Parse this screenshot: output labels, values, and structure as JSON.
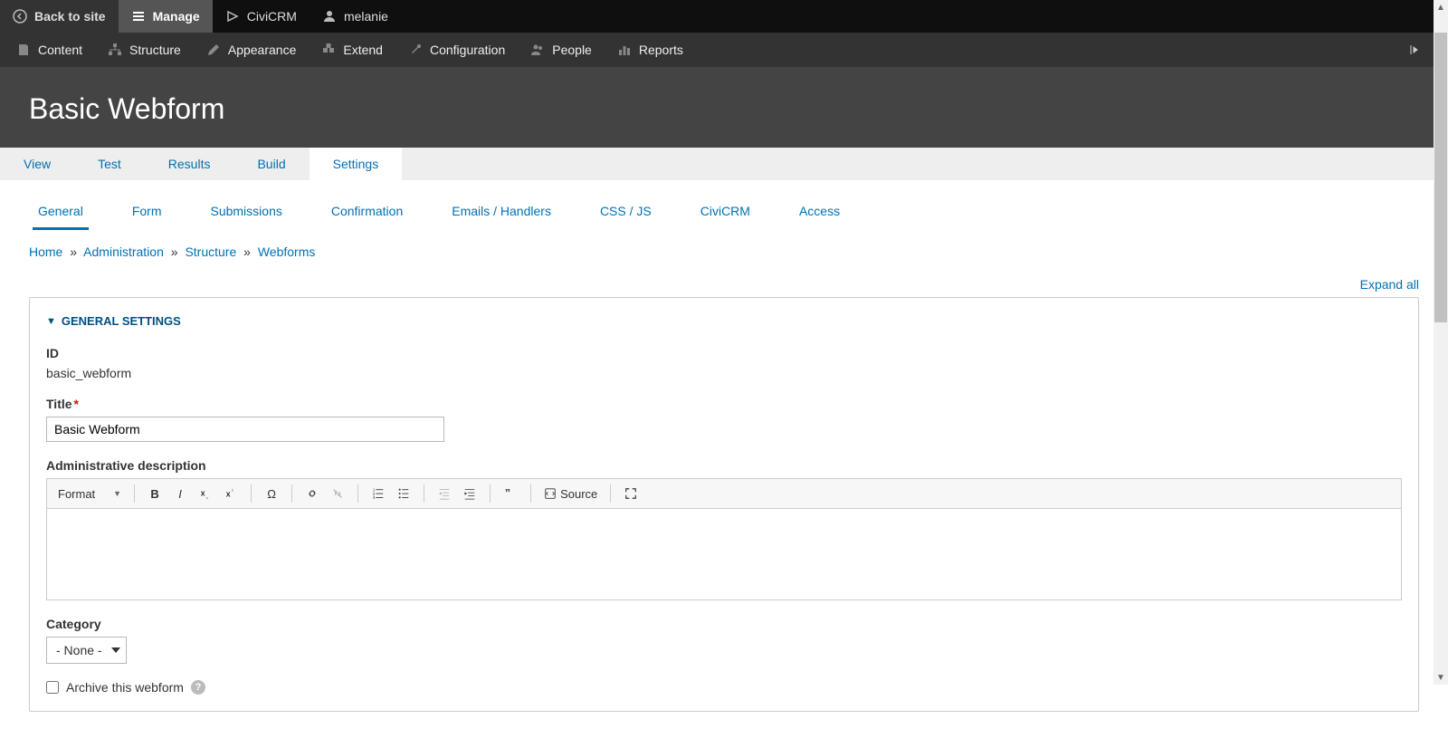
{
  "toolbar_top": {
    "back": "Back to site",
    "manage": "Manage",
    "civicrm": "CiviCRM",
    "user": "melanie"
  },
  "toolbar_admin": {
    "content": "Content",
    "structure": "Structure",
    "appearance": "Appearance",
    "extend": "Extend",
    "configuration": "Configuration",
    "people": "People",
    "reports": "Reports"
  },
  "page_title": "Basic Webform",
  "primary_tabs": {
    "view": "View",
    "test": "Test",
    "results": "Results",
    "build": "Build",
    "settings": "Settings"
  },
  "secondary_tabs": {
    "general": "General",
    "form": "Form",
    "submissions": "Submissions",
    "confirmation": "Confirmation",
    "emails": "Emails / Handlers",
    "cssjs": "CSS / JS",
    "civicrm": "CiviCRM",
    "access": "Access"
  },
  "breadcrumb": {
    "home": "Home",
    "admin": "Administration",
    "structure": "Structure",
    "webforms": "Webforms"
  },
  "expand_all": "Expand all",
  "fieldset": {
    "legend": "GENERAL SETTINGS",
    "id_label": "ID",
    "id_value": "basic_webform",
    "title_label": "Title",
    "title_value": "Basic Webform",
    "admin_desc_label": "Administrative description",
    "category_label": "Category",
    "category_value": "- None -",
    "archive_label": "Archive this webform"
  },
  "editor": {
    "format": "Format",
    "source": "Source"
  }
}
